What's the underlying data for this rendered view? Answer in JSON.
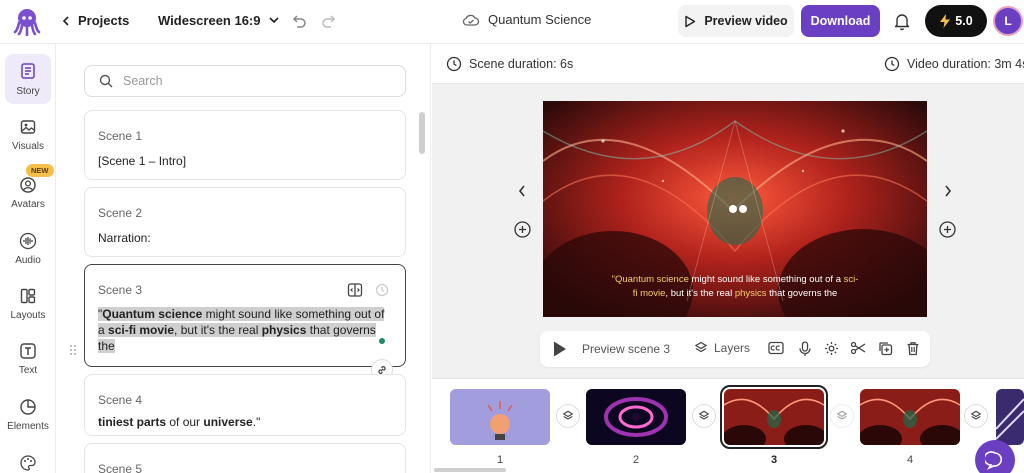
{
  "header": {
    "back_label": "Projects",
    "format_label": "Widescreen 16:9",
    "project_title": "Quantum Science",
    "preview_label": "Preview video",
    "download_label": "Download",
    "credits": "5.0",
    "avatar_initial": "L",
    "accent": "#6a3fc1"
  },
  "nav": {
    "items": [
      {
        "label": "Story",
        "icon": "story-icon",
        "active": true
      },
      {
        "label": "Visuals",
        "icon": "image-icon"
      },
      {
        "label": "Avatars",
        "icon": "avatar-icon",
        "badge": "NEW"
      },
      {
        "label": "Audio",
        "icon": "audio-wave-icon"
      },
      {
        "label": "Layouts",
        "icon": "layout-icon"
      },
      {
        "label": "Text",
        "icon": "text-icon"
      },
      {
        "label": "Elements",
        "icon": "pie-icon"
      }
    ]
  },
  "script": {
    "search_placeholder": "Search",
    "scenes": [
      {
        "label": "Scene 1",
        "text": "[Scene 1 – Intro]"
      },
      {
        "label": "Scene 2",
        "text": "Narration:"
      },
      {
        "label": "Scene 3",
        "t1": "\"",
        "b1": "Quantum science",
        "t2": " might sound like something out of",
        "t3": "a ",
        "b2": "sci-fi movie",
        "t4": ", but it's the real ",
        "b3": "physics",
        "t5": " that governs",
        "t6": "the"
      },
      {
        "label": "Scene 4",
        "b1": "tiniest parts",
        "t1": " of our ",
        "b2": "universe",
        "t2": ".\""
      },
      {
        "label": "Scene 5"
      }
    ]
  },
  "preview": {
    "scene_duration": "Scene duration: 6s",
    "video_duration": "Video duration: 3m 4s",
    "caption_w1": "\"Quantum science",
    "caption_t1": " might sound like something out of a ",
    "caption_w2": "sci-",
    "caption_w3": "fi movie",
    "caption_t2": ", but it's the real ",
    "caption_w4": "physics",
    "caption_t3": " that governs the",
    "preview_scene_label": "Preview scene 3",
    "layers_label": "Layers"
  },
  "filmstrip": {
    "scenes": [
      "1",
      "2",
      "3",
      "4"
    ],
    "selected": "3"
  }
}
